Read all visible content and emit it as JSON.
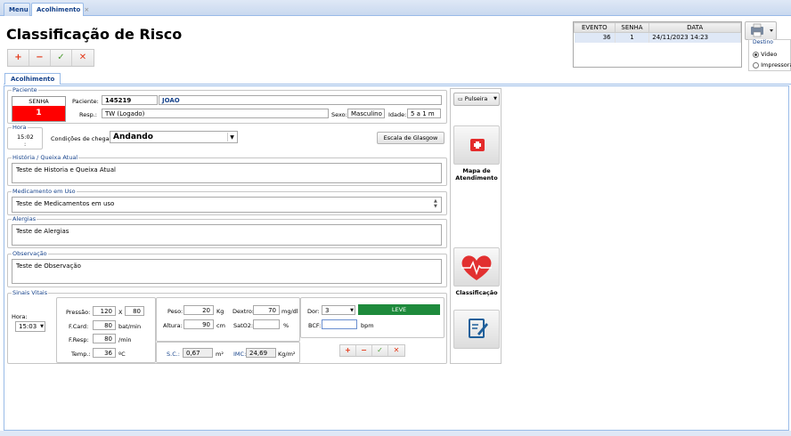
{
  "tabs": [
    {
      "label": "Menu"
    },
    {
      "label": "Acolhimento",
      "close": "×"
    }
  ],
  "page_title": "Classificação de Risco",
  "toolbar": {
    "add": "+",
    "remove": "−",
    "confirm": "✓",
    "cancel": "✕"
  },
  "events": {
    "headers": [
      "EVENTO",
      "SENHA",
      "DATA"
    ],
    "row": [
      "36",
      "1",
      "24/11/2023 14:23"
    ]
  },
  "destino": {
    "legend": "Destino",
    "options": [
      "Video",
      "Impressora"
    ],
    "selected": "Video"
  },
  "subtab": "Acolhimento",
  "paciente": {
    "legend": "Paciente",
    "senha_label": "SENHA",
    "senha_value": "1",
    "paciente_label": "Paciente:",
    "paciente_id": "145219",
    "paciente_nome": "JOAO",
    "resp_label": "Resp.:",
    "resp_value": "TW (Logado)",
    "sexo_label": "Sexo:",
    "sexo_value": "Masculino",
    "idade_label": "Idade:",
    "idade_value": "5 a 1 m"
  },
  "pulseira": "Pulseira",
  "hora": {
    "legend": "Hora",
    "value": "15:02",
    ":": ":"
  },
  "chegada": {
    "label": "Condições de chegada:",
    "value": "Andando"
  },
  "glasgow": "Escala de Glasgow",
  "historia": {
    "legend": "História / Queixa Atual",
    "value": "Teste de Historia e Queixa Atual"
  },
  "medicamento": {
    "legend": "Medicamento em Uso",
    "value": "Teste de Medicamentos em uso"
  },
  "alergias": {
    "legend": "Alergias",
    "value": "Teste de Alergias"
  },
  "observacao": {
    "legend": "Observação",
    "value": "Teste de Observação"
  },
  "vitais": {
    "legend": "Sinais Vitais",
    "hora_label": "Hora:",
    "hora_value": "15:03",
    "pressao_label": "Pressão:",
    "pressao1": "120",
    "x": "X",
    "pressao2": "80",
    "fcard_label": "F.Card:",
    "fcard": "80",
    "fcard_unit": "bat/min",
    "fresp_label": "F.Resp:",
    "fresp": "80",
    "fresp_unit": "/min",
    "temp_label": "Temp.:",
    "temp": "36",
    "temp_unit": "ºC",
    "peso_label": "Peso:",
    "peso": "20",
    "peso_unit": "Kg",
    "altura_label": "Altura:",
    "altura": "90",
    "altura_unit": "cm",
    "dextro_label": "Dextro:",
    "dextro": "70",
    "dextro_unit": "mg/dl",
    "sat_label": "SatO2:",
    "sat": "",
    "sat_unit": "%",
    "sc_label": "S.C.:",
    "sc": "0,67",
    "sc_unit": "m²",
    "imc_label": "IMC:",
    "imc": "24,69",
    "imc_unit": "Kg/m²",
    "dor_label": "Dor:",
    "dor": "3",
    "dor_level": "LEVE",
    "bcf_label": "BCF:",
    "bcf": "",
    "bcf_unit": "bpm"
  },
  "side": {
    "mapa": "Mapa de Atendimento",
    "classificacao": "Classificação"
  },
  "colors": {
    "senha_bg": "#ff0000",
    "leve_bg": "#1e8a3c",
    "accent": "#15428b"
  }
}
